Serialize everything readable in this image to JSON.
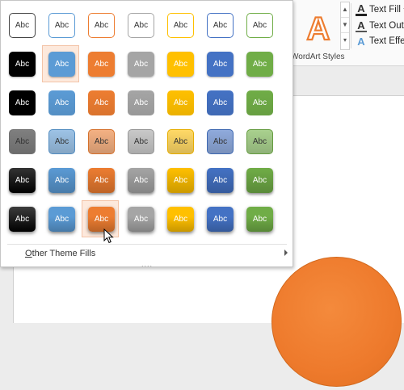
{
  "ribbon": {
    "wordart_label": "WordArt Styles",
    "wordart_glyph": "A",
    "scroll_up": "▲",
    "scroll_down": "▼",
    "scroll_more": "▾",
    "text_fill": "Text Fill",
    "text_outline": "Text Outli",
    "text_effects": "Text Effec",
    "text_icon": "A"
  },
  "gallery": {
    "swatch_text": "Abc",
    "other_fills_prefix": "O",
    "other_fills_rest": "ther Theme Fills",
    "grip": "....",
    "colors": [
      "#000000",
      "#5b9bd5",
      "#ed7d31",
      "#a5a5a5",
      "#ffc000",
      "#4472c4",
      "#70ad47"
    ],
    "light_colors": [
      "#7f7f7f",
      "#9dc3e6",
      "#f4b183",
      "#c9c9c9",
      "#ffd966",
      "#8faadc",
      "#a9d18e"
    ],
    "selected_row": 1,
    "selected_col": 1,
    "hover_row": 5,
    "hover_col": 2
  },
  "shape": {
    "fill": "#ed7d31"
  }
}
